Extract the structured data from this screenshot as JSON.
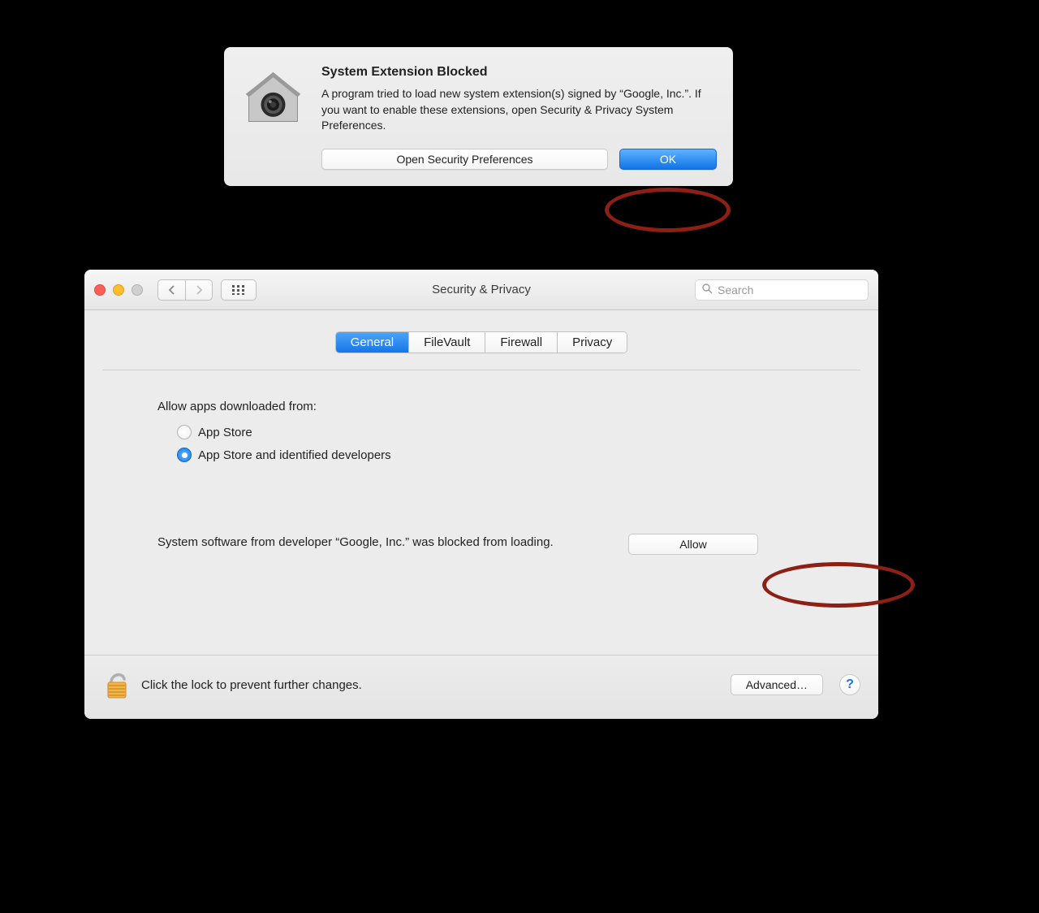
{
  "alert": {
    "title": "System Extension Blocked",
    "body": "A program tried to load new system extension(s) signed by “Google, Inc.”.  If you want to enable these extensions, open Security & Privacy System Preferences.",
    "secondary_button": "Open Security Preferences",
    "primary_button": "OK"
  },
  "prefs": {
    "window_title": "Security & Privacy",
    "search_placeholder": "Search",
    "tabs": {
      "general": "General",
      "filevault": "FileVault",
      "firewall": "Firewall",
      "privacy": "Privacy"
    },
    "allow_apps_label": "Allow apps downloaded from:",
    "radio_appstore": "App Store",
    "radio_appstore_dev": "App Store and identified developers",
    "blocked_message": "System software from developer “Google, Inc.” was blocked from loading.",
    "allow_button": "Allow",
    "lock_text": "Click the lock to prevent further changes.",
    "advanced_button": "Advanced…",
    "help_button": "?"
  }
}
